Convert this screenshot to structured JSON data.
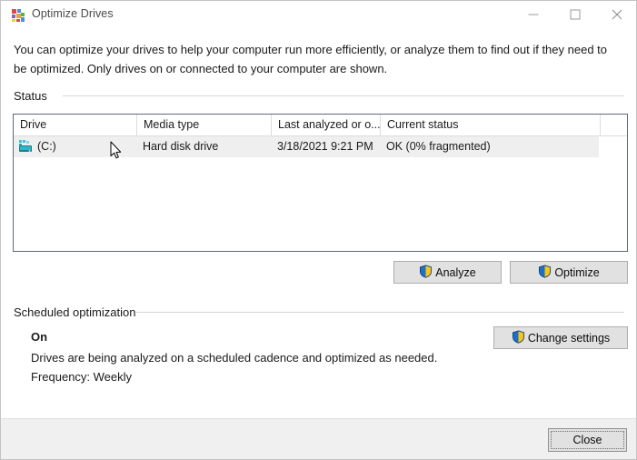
{
  "window": {
    "title": "Optimize Drives",
    "icon": "defrag-icon",
    "controls": {
      "minimize": "minimize-icon",
      "maximize": "maximize-icon",
      "close": "close-icon"
    }
  },
  "intro": "You can optimize your drives to help your computer run more efficiently, or analyze them to find out if they need to be optimized. Only drives on or connected to your computer are shown.",
  "status_section": {
    "label": "Status",
    "table": {
      "columns": [
        "Drive",
        "Media type",
        "Last analyzed or o...",
        "Current status"
      ],
      "rows": [
        {
          "icon": "hard-drive-icon",
          "drive": "(C:)",
          "media_type": "Hard disk drive",
          "last_analyzed": "3/18/2021 9:21 PM",
          "current_status": "OK (0% fragmented)",
          "selected": true
        }
      ]
    },
    "buttons": {
      "analyze": "Analyze",
      "optimize": "Optimize"
    }
  },
  "scheduled_section": {
    "label": "Scheduled optimization",
    "state": "On",
    "description": "Drives are being analyzed on a scheduled cadence and optimized as needed.",
    "frequency": "Frequency: Weekly",
    "change_settings": "Change settings"
  },
  "footer": {
    "close": "Close"
  },
  "colors": {
    "window_bg": "#ffffff",
    "footer_bg": "#f0f0f0",
    "button_face": "#e1e1e1",
    "button_border": "#adadad",
    "table_border": "#5d6a7a",
    "row_selected": "#efefef",
    "text": "#1a1a1a",
    "title_text": "#4a4a4a",
    "shield_blue": "#1f6fc4",
    "shield_gold": "#f5c518",
    "drive_icon": "#2aa3b5"
  }
}
